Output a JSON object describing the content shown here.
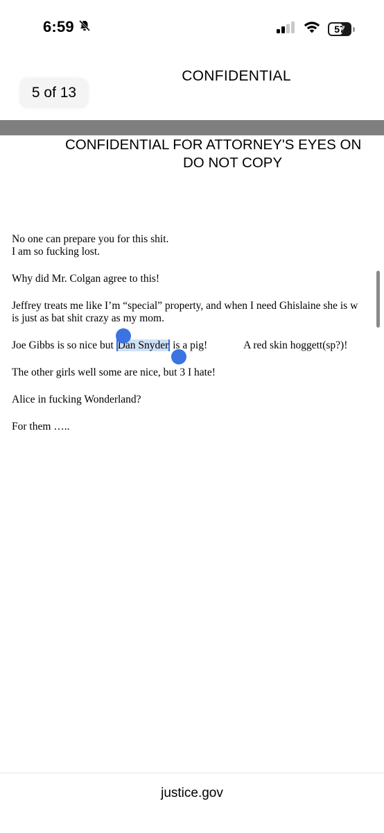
{
  "status_bar": {
    "time": "6:59",
    "battery_percent": "57",
    "icons": [
      "bell-slash-icon",
      "cellular-signal-icon",
      "wifi-icon",
      "battery-icon"
    ]
  },
  "viewer": {
    "header_title": "CONFIDENTIAL",
    "page_indicator": "5 of 13"
  },
  "document": {
    "banner_line1": "CONFIDENTIAL FOR ATTORNEY'S EYES ON",
    "banner_line2": "DO NOT COPY",
    "paragraphs": {
      "p1_line1": "No one can prepare you for this shit.",
      "p1_line2": "I am so fucking lost.",
      "p2": "Why did Mr. Colgan agree to this!",
      "p3_line1": "Jeffrey treats me like I’m “special” property, and when I need Ghislaine she is w",
      "p3_line2": "is just as bat shit crazy as my mom.",
      "p4_before": "Joe Gibbs is so nice but ",
      "p4_selected": "Dan Snyder",
      "p4_after": " is a pig!",
      "p4_tail": "A red skin hoggett(sp?)!",
      "p5": "The other girls well some are nice, but 3 I hate!",
      "p6": "Alice in fucking Wonderland?",
      "p7": "For them ….."
    }
  },
  "browser": {
    "url": "justice.gov"
  },
  "colors": {
    "selection_fill": "#cfe0f6",
    "selection_handle": "#3b73e0",
    "page_separator": "#7f7f7f"
  }
}
